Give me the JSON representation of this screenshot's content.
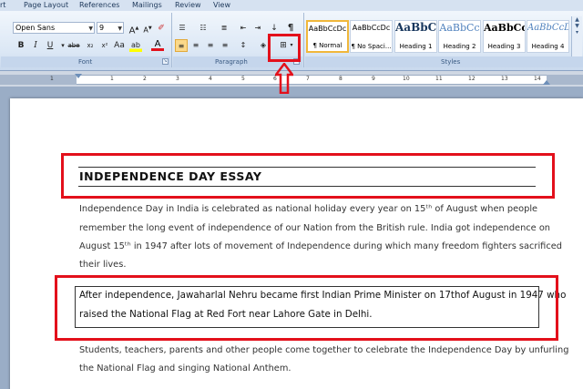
{
  "tabs": [
    "rt",
    "Page Layout",
    "References",
    "Mailings",
    "Review",
    "View"
  ],
  "font_group": {
    "font_name": "Open Sans",
    "font_size": "9",
    "label": "Font",
    "bold": "B",
    "italic": "I",
    "underline": "U",
    "strike": "abe",
    "subscript": "x₂",
    "superscript": "x²",
    "highlight": "ab",
    "font_color": "A"
  },
  "paragraph_group": {
    "label": "Paragraph",
    "sort": "↓",
    "pilcrow": "¶"
  },
  "styles_group": {
    "label": "Styles",
    "items": [
      {
        "sample": "AaBbCcDc",
        "name": "¶ Normal"
      },
      {
        "sample": "AaBbCcDc",
        "name": "¶ No Spaci..."
      },
      {
        "sample": "AaBbC",
        "name": "Heading 1"
      },
      {
        "sample": "AaBbCc",
        "name": "Heading 2"
      },
      {
        "sample": "AaBbCc",
        "name": "Heading 3"
      },
      {
        "sample": "AaBbCcD",
        "name": "Heading 4"
      }
    ]
  },
  "ruler_numbers": [
    "1",
    "1",
    "2",
    "3",
    "4",
    "5",
    "6",
    "7",
    "8",
    "9",
    "10",
    "11",
    "12",
    "13",
    "14"
  ],
  "document": {
    "title": "INDEPENDENCE  DAY ESSAY",
    "para1": [
      "Independence Day in India is celebrated as national holiday every year on 15ᵗʰ of August when people",
      "remember the long event of independence of our Nation from the British rule. India got independence on",
      "August 15ᵗʰ in 1947 after lots of movement of Independence during which many freedom fighters sacrificed",
      "their lives."
    ],
    "para2": [
      "After independence, Jawaharlal Nehru became first Indian Prime Minister on 17thof August in 1947 who",
      "raised the National Flag at Red Fort near Lahore Gate in Delhi."
    ],
    "para3": [
      "Students, teachers, parents and other people come together to celebrate the Independence Day by unfurling",
      "the National Flag and singing National Anthem."
    ]
  },
  "colors": {
    "highlight_annotation": "#e3101b",
    "selected_style_border": "#f0b73b",
    "ribbon_bg": "#dbe7f5"
  }
}
